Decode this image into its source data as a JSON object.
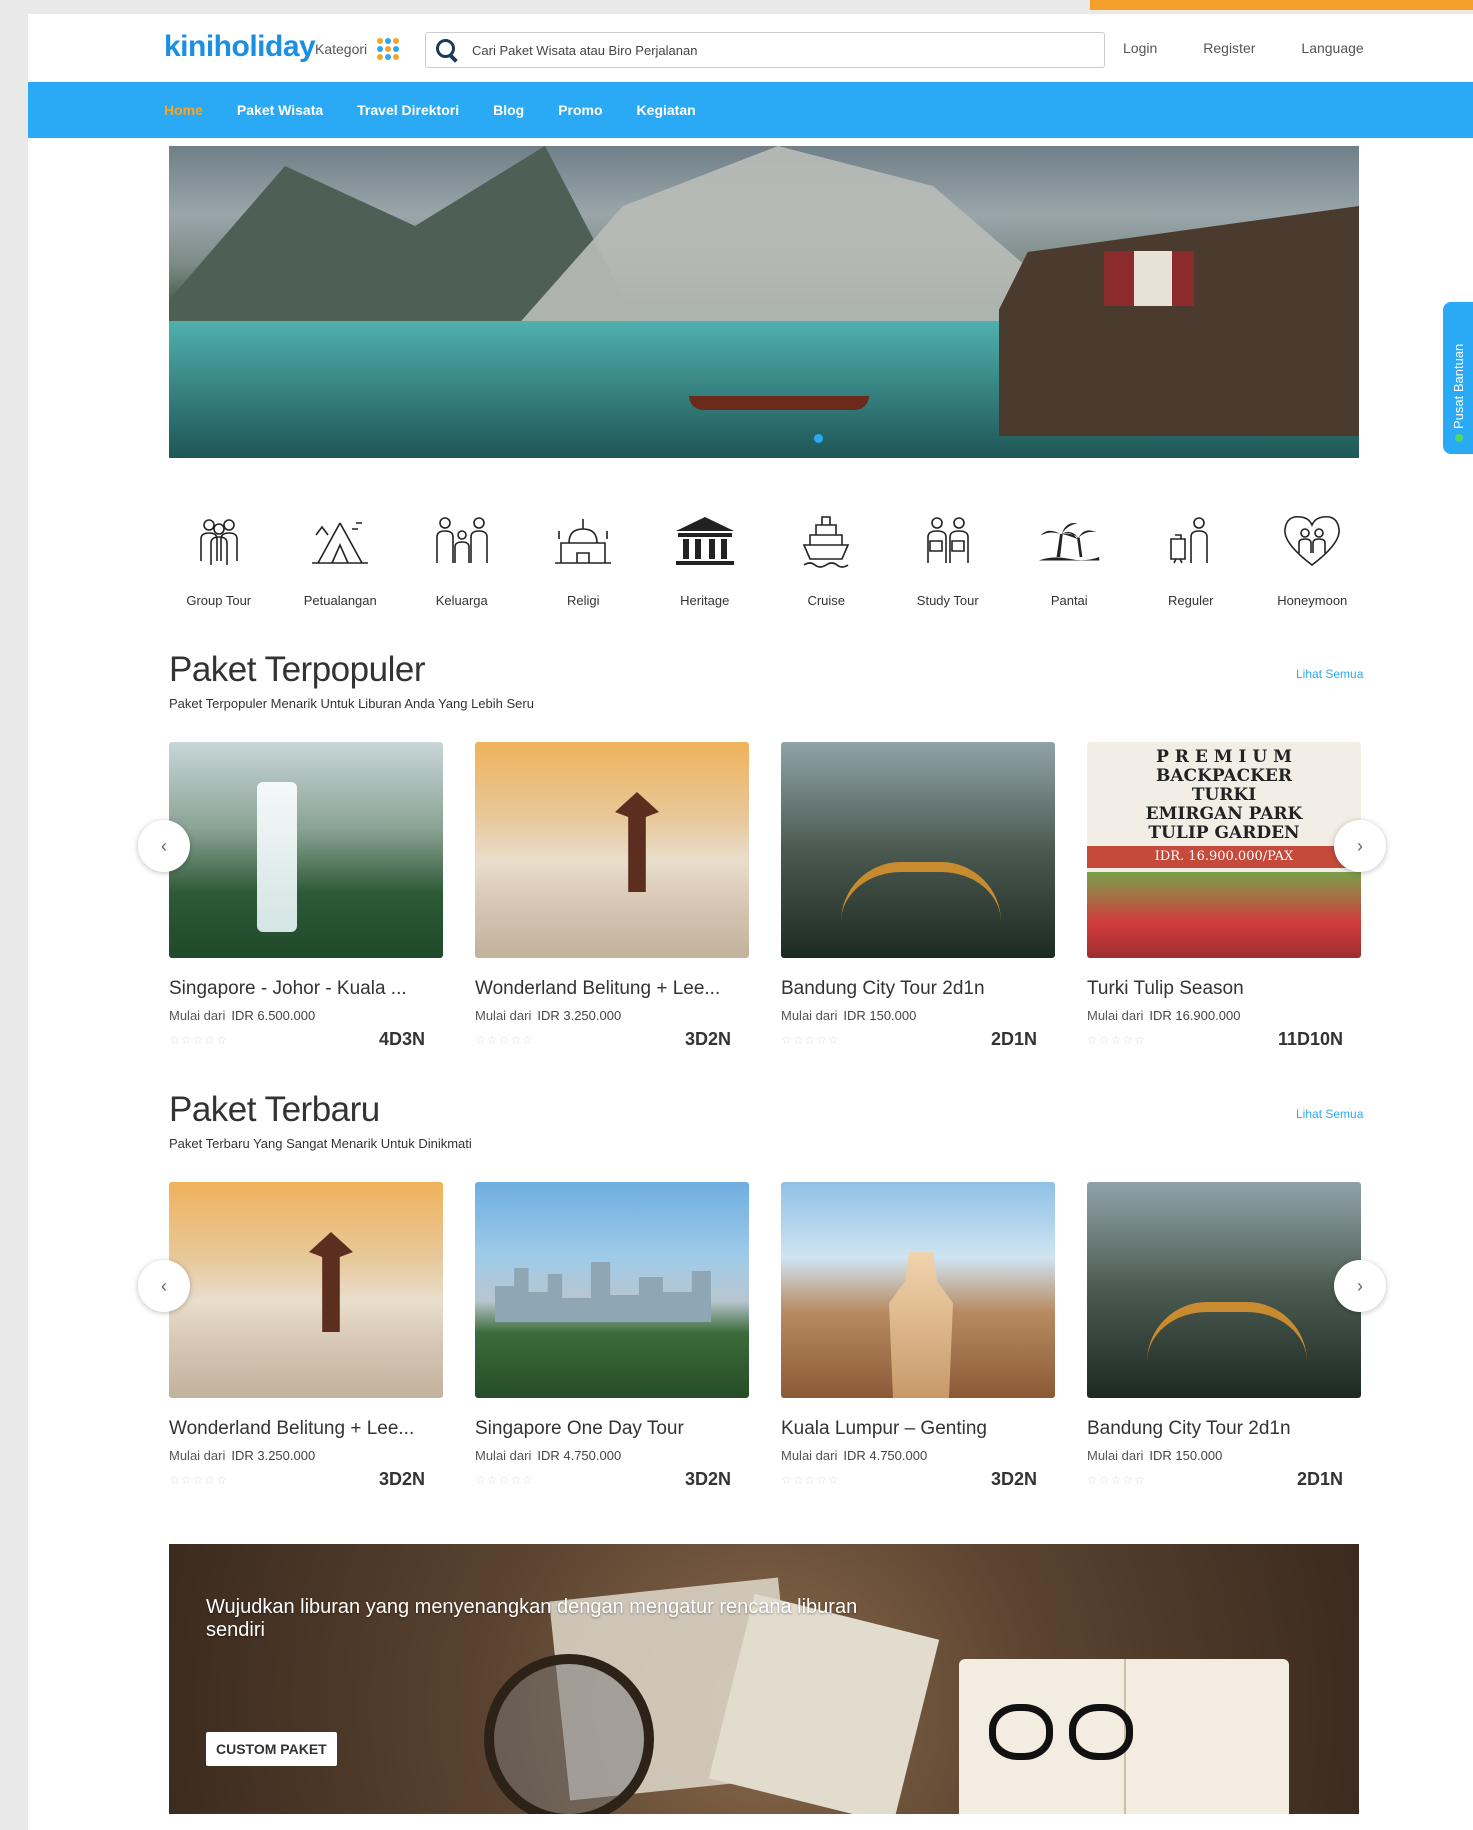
{
  "header": {
    "logo": "kiniholiday",
    "kategori_label": "Kategori",
    "search_placeholder": "Cari Paket Wisata atau Biro Perjalanan",
    "links": [
      "Login",
      "Register",
      "Language"
    ]
  },
  "nav": {
    "items": [
      "Home",
      "Paket Wisata",
      "Travel Direktori",
      "Blog",
      "Promo",
      "Kegiatan"
    ],
    "active": "Home"
  },
  "categories": [
    "Group Tour",
    "Petualangan",
    "Keluarga",
    "Religi",
    "Heritage",
    "Cruise",
    "Study Tour",
    "Pantai",
    "Reguler",
    "Honeymoon"
  ],
  "popular": {
    "title": "Paket Terpopuler",
    "subtitle": "Paket Terpopuler Menarik Untuk Liburan Anda Yang Lebih Seru",
    "see_all": "Lihat Semua",
    "cards": [
      {
        "name": "Singapore - Johor - Kuala ...",
        "price_label": "Mulai dari",
        "price": "IDR 6.500.000",
        "duration": "4D3N"
      },
      {
        "name": "Wonderland Belitung + Lee...",
        "price_label": "Mulai dari",
        "price": "IDR 3.250.000",
        "duration": "3D2N"
      },
      {
        "name": "Bandung City Tour 2d1n",
        "price_label": "Mulai dari",
        "price": "IDR 150.000",
        "duration": "2D1N"
      },
      {
        "name": "Turki Tulip Season",
        "price_label": "Mulai dari",
        "price": "IDR 16.900.000",
        "duration": "11D10N"
      }
    ]
  },
  "turki_poster": {
    "line1": "P R E M I U M",
    "line2": "BACKPACKER",
    "line3": "TURKI",
    "line4": "EMIRGAN PARK",
    "line5": "TULIP GARDEN",
    "band": "IDR. 16.900.000/PAX"
  },
  "newest": {
    "title": "Paket Terbaru",
    "subtitle": "Paket Terbaru Yang Sangat Menarik Untuk Dinikmati",
    "see_all": "Lihat Semua",
    "cards": [
      {
        "name": "Wonderland Belitung + Lee...",
        "price_label": "Mulai dari",
        "price": "IDR 3.250.000",
        "duration": "3D2N"
      },
      {
        "name": "Singapore One Day Tour",
        "price_label": "Mulai dari",
        "price": "IDR 4.750.000",
        "duration": "3D2N"
      },
      {
        "name": "Kuala Lumpur – Genting",
        "price_label": "Mulai dari",
        "price": "IDR 4.750.000",
        "duration": "3D2N"
      },
      {
        "name": "Bandung City Tour 2d1n",
        "price_label": "Mulai dari",
        "price": "IDR 150.000",
        "duration": "2D1N"
      }
    ]
  },
  "cta": {
    "text": "Wujudkan liburan yang menyenangkan dengan mengatur rencana liburan sendiri",
    "button": "CUSTOM PAKET"
  },
  "help_tab": "Pusat Bantuan",
  "colors": {
    "accent": "#2aaaf5",
    "nav_active": "#f5a623",
    "logo": "#1a8fe3"
  },
  "icons": {
    "search": "search-icon",
    "kategori": "grid-icon",
    "prev": "chevron-left-icon",
    "next": "chevron-right-icon"
  }
}
